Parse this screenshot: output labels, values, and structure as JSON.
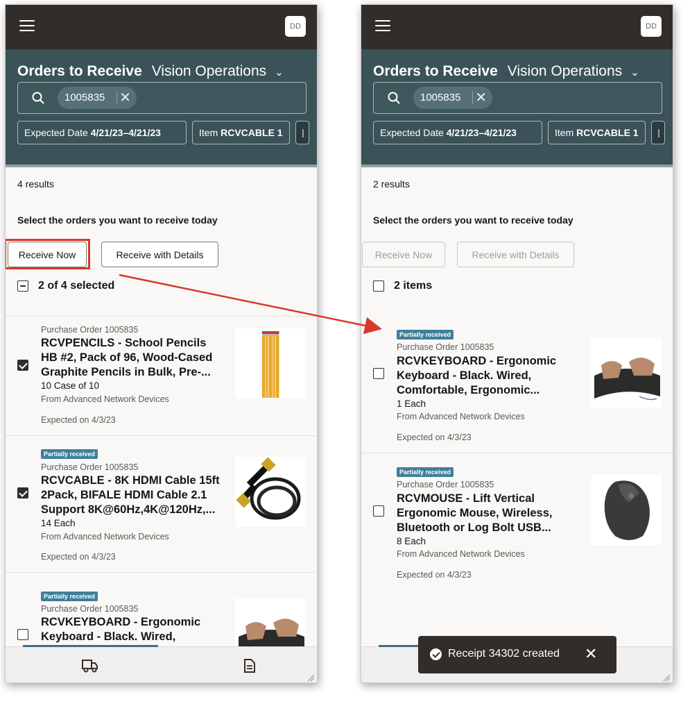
{
  "left": {
    "avatar": "DD",
    "title": "Orders to Receive",
    "org": "Vision Operations",
    "search_chip": "1005835",
    "filters": [
      {
        "label": "Expected Date",
        "value": "4/21/23–4/21/23"
      },
      {
        "label": "Item",
        "value": "RCVCABLE 1"
      }
    ],
    "results": "4 results",
    "instructions": "Select the orders you want to receive today",
    "receive_now": "Receive Now",
    "receive_details": "Receive with Details",
    "selection": "2 of 4 selected",
    "orders": [
      {
        "badge": "",
        "po": "Purchase Order 1005835",
        "title": "RCVPENCILS - School Pencils HB #2, Pack of 96, Wood-Cased Graphite Pencils in Bulk, Pre-...",
        "qty": "10 Case of 10",
        "supplier": "From Advanced Network Devices",
        "expected": "Expected on 4/3/23",
        "checked": true,
        "image": "pencils"
      },
      {
        "badge": "Partially received",
        "po": "Purchase Order 1005835",
        "title": "RCVCABLE - 8K HDMI Cable 15ft 2Pack, BIFALE HDMI Cable 2.1 Support 8K@60Hz,4K@120Hz,...",
        "qty": "14 Each",
        "supplier": "From Advanced Network Devices",
        "expected": "Expected on 4/3/23",
        "checked": true,
        "image": "hdmi-cable"
      },
      {
        "badge": "Partially received",
        "po": "Purchase Order 1005835",
        "title": "RCVKEYBOARD - Ergonomic Keyboard - Black. Wired, Comfortable, Ergonomic",
        "qty": "",
        "supplier": "",
        "expected": "",
        "checked": false,
        "image": "keyboard"
      }
    ]
  },
  "right": {
    "avatar": "DD",
    "title": "Orders to Receive",
    "org": "Vision Operations",
    "search_chip": "1005835",
    "filters": [
      {
        "label": "Expected Date",
        "value": "4/21/23–4/21/23"
      },
      {
        "label": "Item",
        "value": "RCVCABLE 1"
      }
    ],
    "results": "2 results",
    "instructions": "Select the orders you want to receive today",
    "receive_now": "Receive Now",
    "receive_details": "Receive with Details",
    "selection": "2 items",
    "orders": [
      {
        "badge": "Partially received",
        "po": "Purchase Order 1005835",
        "title": "RCVKEYBOARD - Ergonomic Keyboard - Black. Wired, Comfortable, Ergonomic...",
        "qty": "1 Each",
        "supplier": "From Advanced Network Devices",
        "expected": "Expected on 4/3/23",
        "checked": false,
        "image": "keyboard"
      },
      {
        "badge": "Partially received",
        "po": "Purchase Order 1005835",
        "title": "RCVMOUSE - Lift Vertical Ergonomic Mouse, Wireless, Bluetooth or Log Bolt USB...",
        "qty": "8 Each",
        "supplier": "From Advanced Network Devices",
        "expected": "Expected on 4/3/23",
        "checked": false,
        "image": "mouse"
      }
    ],
    "toast": "Receipt 34302 created"
  },
  "icons": [
    "hamburger-icon",
    "search-icon",
    "close-icon",
    "chevron-down-icon",
    "truck-icon",
    "document-icon",
    "check-circle-icon"
  ],
  "colors": {
    "topbar": "#312d2a",
    "header": "#3b5358",
    "badge": "#3f7f9a",
    "highlight": "#d9382a",
    "arrow": "#d9382a"
  }
}
